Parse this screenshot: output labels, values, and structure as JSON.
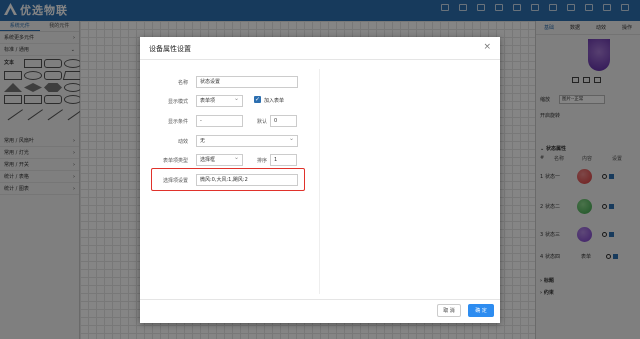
{
  "app": {
    "title": "优选物联"
  },
  "toolbar": [
    {
      "icon": "grid-icon",
      "label": ""
    },
    {
      "icon": "zoom-icon",
      "label": ""
    },
    {
      "icon": "font-icon",
      "label": ""
    },
    {
      "icon": "edit-icon",
      "label": ""
    },
    {
      "icon": "rotate-icon",
      "label": ""
    },
    {
      "icon": "undo-icon",
      "label": ""
    },
    {
      "icon": "redo-icon",
      "label": ""
    },
    {
      "icon": "delete-icon",
      "label": ""
    },
    {
      "icon": "preview-icon",
      "label": ""
    },
    {
      "icon": "save-icon",
      "label": ""
    },
    {
      "icon": "publish-icon",
      "label": ""
    },
    {
      "icon": "exit-icon",
      "label": ""
    }
  ],
  "left_panel": {
    "tabs": [
      "系统元件",
      "我的元件"
    ],
    "sections_top": [
      "系统更多元件",
      "标准 / 通用"
    ],
    "text_label": "文本",
    "sections_bottom": [
      "常用 / 风扇叶",
      "常用 / 灯光",
      "常用 / 开关",
      "统计 / 表格",
      "统计 / 图表"
    ]
  },
  "right_panel": {
    "tabs": [
      "基础",
      "数据",
      "动效",
      "操作"
    ],
    "zoom_label": "缩放",
    "zoom_value": "图片--正常",
    "rotate_label": "开启旋转",
    "state_header": "状态属性",
    "state_columns": [
      "#",
      "名称",
      "内容",
      "设置"
    ],
    "states": [
      {
        "index": "1",
        "name": "状态一",
        "color": "#d93a3a"
      },
      {
        "index": "2",
        "name": "状态二",
        "color": "#3aa34a"
      },
      {
        "index": "3",
        "name": "状态三",
        "color": "#7a3ec9"
      },
      {
        "index": "4",
        "name": "状态四",
        "content": "表单"
      }
    ],
    "footer_sections": [
      "标题",
      "约束"
    ]
  },
  "dialog": {
    "title": "设备属性设置",
    "close_glyph": "×",
    "fields": {
      "name_label": "名称",
      "name_value": "状态设置",
      "display_mode_label": "显示模式",
      "display_mode_value": "表单项",
      "join_form_label": "加入表单",
      "display_condition_label": "显示条件",
      "display_condition_value": "-",
      "default_label": "默认",
      "default_value": "0",
      "animation_label": "动效",
      "animation_value": "无",
      "form_item_type_label": "表单项类型",
      "form_item_type_value": "选择框",
      "sort_label": "排序",
      "sort_value": "1",
      "options_label": "选择项设置",
      "options_value": "微风:0,大风:1,飓风:2"
    },
    "buttons": {
      "cancel": "取 消",
      "ok": "确 定"
    }
  },
  "colors": {
    "brand": "#2d6fb0",
    "primary_button": "#2d8cf0",
    "highlight": "#e0322b"
  }
}
